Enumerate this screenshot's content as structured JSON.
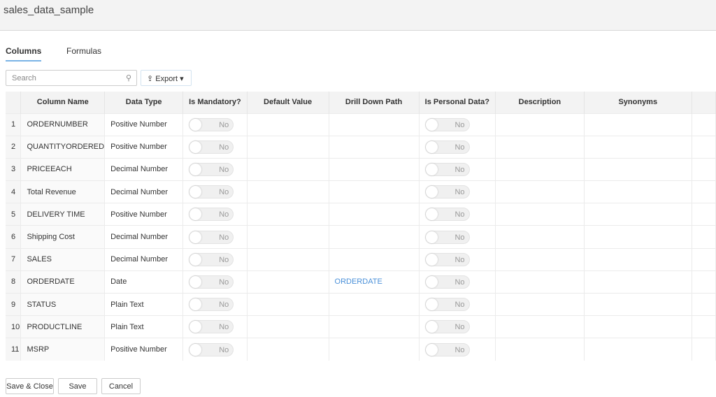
{
  "header": {
    "title": "sales_data_sample"
  },
  "tabs": [
    {
      "label": "Columns",
      "active": true
    },
    {
      "label": "Formulas",
      "active": false
    }
  ],
  "search": {
    "placeholder": "Search"
  },
  "export_label": "Export",
  "table": {
    "headers": [
      "Column Name",
      "Data Type",
      "Is Mandatory?",
      "Default Value",
      "Drill Down Path",
      "Is Personal Data?",
      "Description",
      "Synonyms"
    ],
    "rows": [
      {
        "n": "1",
        "name": "ORDERNUMBER",
        "type": "Positive Number",
        "mandatory": "No",
        "default": "",
        "drill": "",
        "personal": "No"
      },
      {
        "n": "2",
        "name": "QUANTITYORDERED",
        "type": "Positive Number",
        "mandatory": "No",
        "default": "",
        "drill": "",
        "personal": "No"
      },
      {
        "n": "3",
        "name": "PRICEEACH",
        "type": "Decimal Number",
        "mandatory": "No",
        "default": "",
        "drill": "",
        "personal": "No"
      },
      {
        "n": "4",
        "name": "Total Revenue",
        "type": "Decimal Number",
        "mandatory": "No",
        "default": "",
        "drill": "",
        "personal": "No"
      },
      {
        "n": "5",
        "name": "DELIVERY TIME",
        "type": "Positive Number",
        "mandatory": "No",
        "default": "",
        "drill": "",
        "personal": "No"
      },
      {
        "n": "6",
        "name": "Shipping Cost",
        "type": "Decimal Number",
        "mandatory": "No",
        "default": "",
        "drill": "",
        "personal": "No"
      },
      {
        "n": "7",
        "name": "SALES",
        "type": "Decimal Number",
        "mandatory": "No",
        "default": "",
        "drill": "",
        "personal": "No"
      },
      {
        "n": "8",
        "name": "ORDERDATE",
        "type": "Date",
        "mandatory": "No",
        "default": "",
        "drill": "ORDERDATE",
        "personal": "No"
      },
      {
        "n": "9",
        "name": "STATUS",
        "type": "Plain Text",
        "mandatory": "No",
        "default": "",
        "drill": "",
        "personal": "No"
      },
      {
        "n": "10",
        "name": "PRODUCTLINE",
        "type": "Plain Text",
        "mandatory": "No",
        "default": "",
        "drill": "",
        "personal": "No"
      },
      {
        "n": "11",
        "name": "MSRP",
        "type": "Positive Number",
        "mandatory": "No",
        "default": "",
        "drill": "",
        "personal": "No"
      }
    ]
  },
  "footer": {
    "save_close": "Save & Close",
    "save": "Save",
    "cancel": "Cancel"
  }
}
